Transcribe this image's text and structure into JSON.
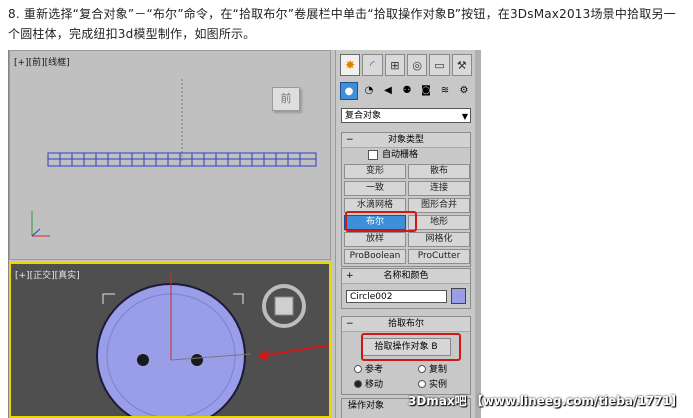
{
  "instruction": {
    "text": "8. 重新选择“复合对象”－“布尔”命令，在“拾取布尔”卷展栏中单击“拾取操作对象B”按钮，在3DsMax2013场景中拾取另一个圆柱体，完成纽扣3d模型制作，如图所示。"
  },
  "viewports": {
    "top_label": "[+][前][线框]",
    "bottom_label": "[+][正交][真实]",
    "viewcube_label": "前"
  },
  "panel": {
    "tabs": [
      "create-icon",
      "modify-icon",
      "hierarchy-icon",
      "motion-icon",
      "display-icon",
      "utilities-icon"
    ],
    "subicons": [
      "geometry-icon",
      "shapes-icon",
      "lights-icon",
      "cameras-icon",
      "helpers-icon",
      "spacewarps-icon",
      "systems-icon"
    ],
    "category_dropdown": "复合对象",
    "object_type": {
      "title": "对象类型",
      "autogrid_label": "自动栅格",
      "buttons": [
        "变形",
        "散布",
        "一致",
        "连接",
        "水滴网格",
        "图形合并",
        "布尔",
        "地形",
        "放样",
        "网格化",
        "ProBoolean",
        "ProCutter"
      ],
      "active_button": "布尔"
    },
    "name_color": {
      "title": "名称和颜色",
      "name_value": "Circle002",
      "color": "#9a9ee8"
    },
    "pick_boolean": {
      "title": "拾取布尔",
      "pick_button": "拾取操作对象 B",
      "options": [
        "参考",
        "复制",
        "移动",
        "实例"
      ],
      "selected_option": "移动"
    },
    "operands": {
      "title": "操作对象"
    }
  },
  "watermark": "3Dmax吧 【www.lineeg.com/tieba/1771】",
  "colors": {
    "highlight_red": "#d01818",
    "active_blue": "#3f8fd8",
    "object_purple": "#9a9ee8",
    "viewport_border_active": "#e8d800"
  }
}
